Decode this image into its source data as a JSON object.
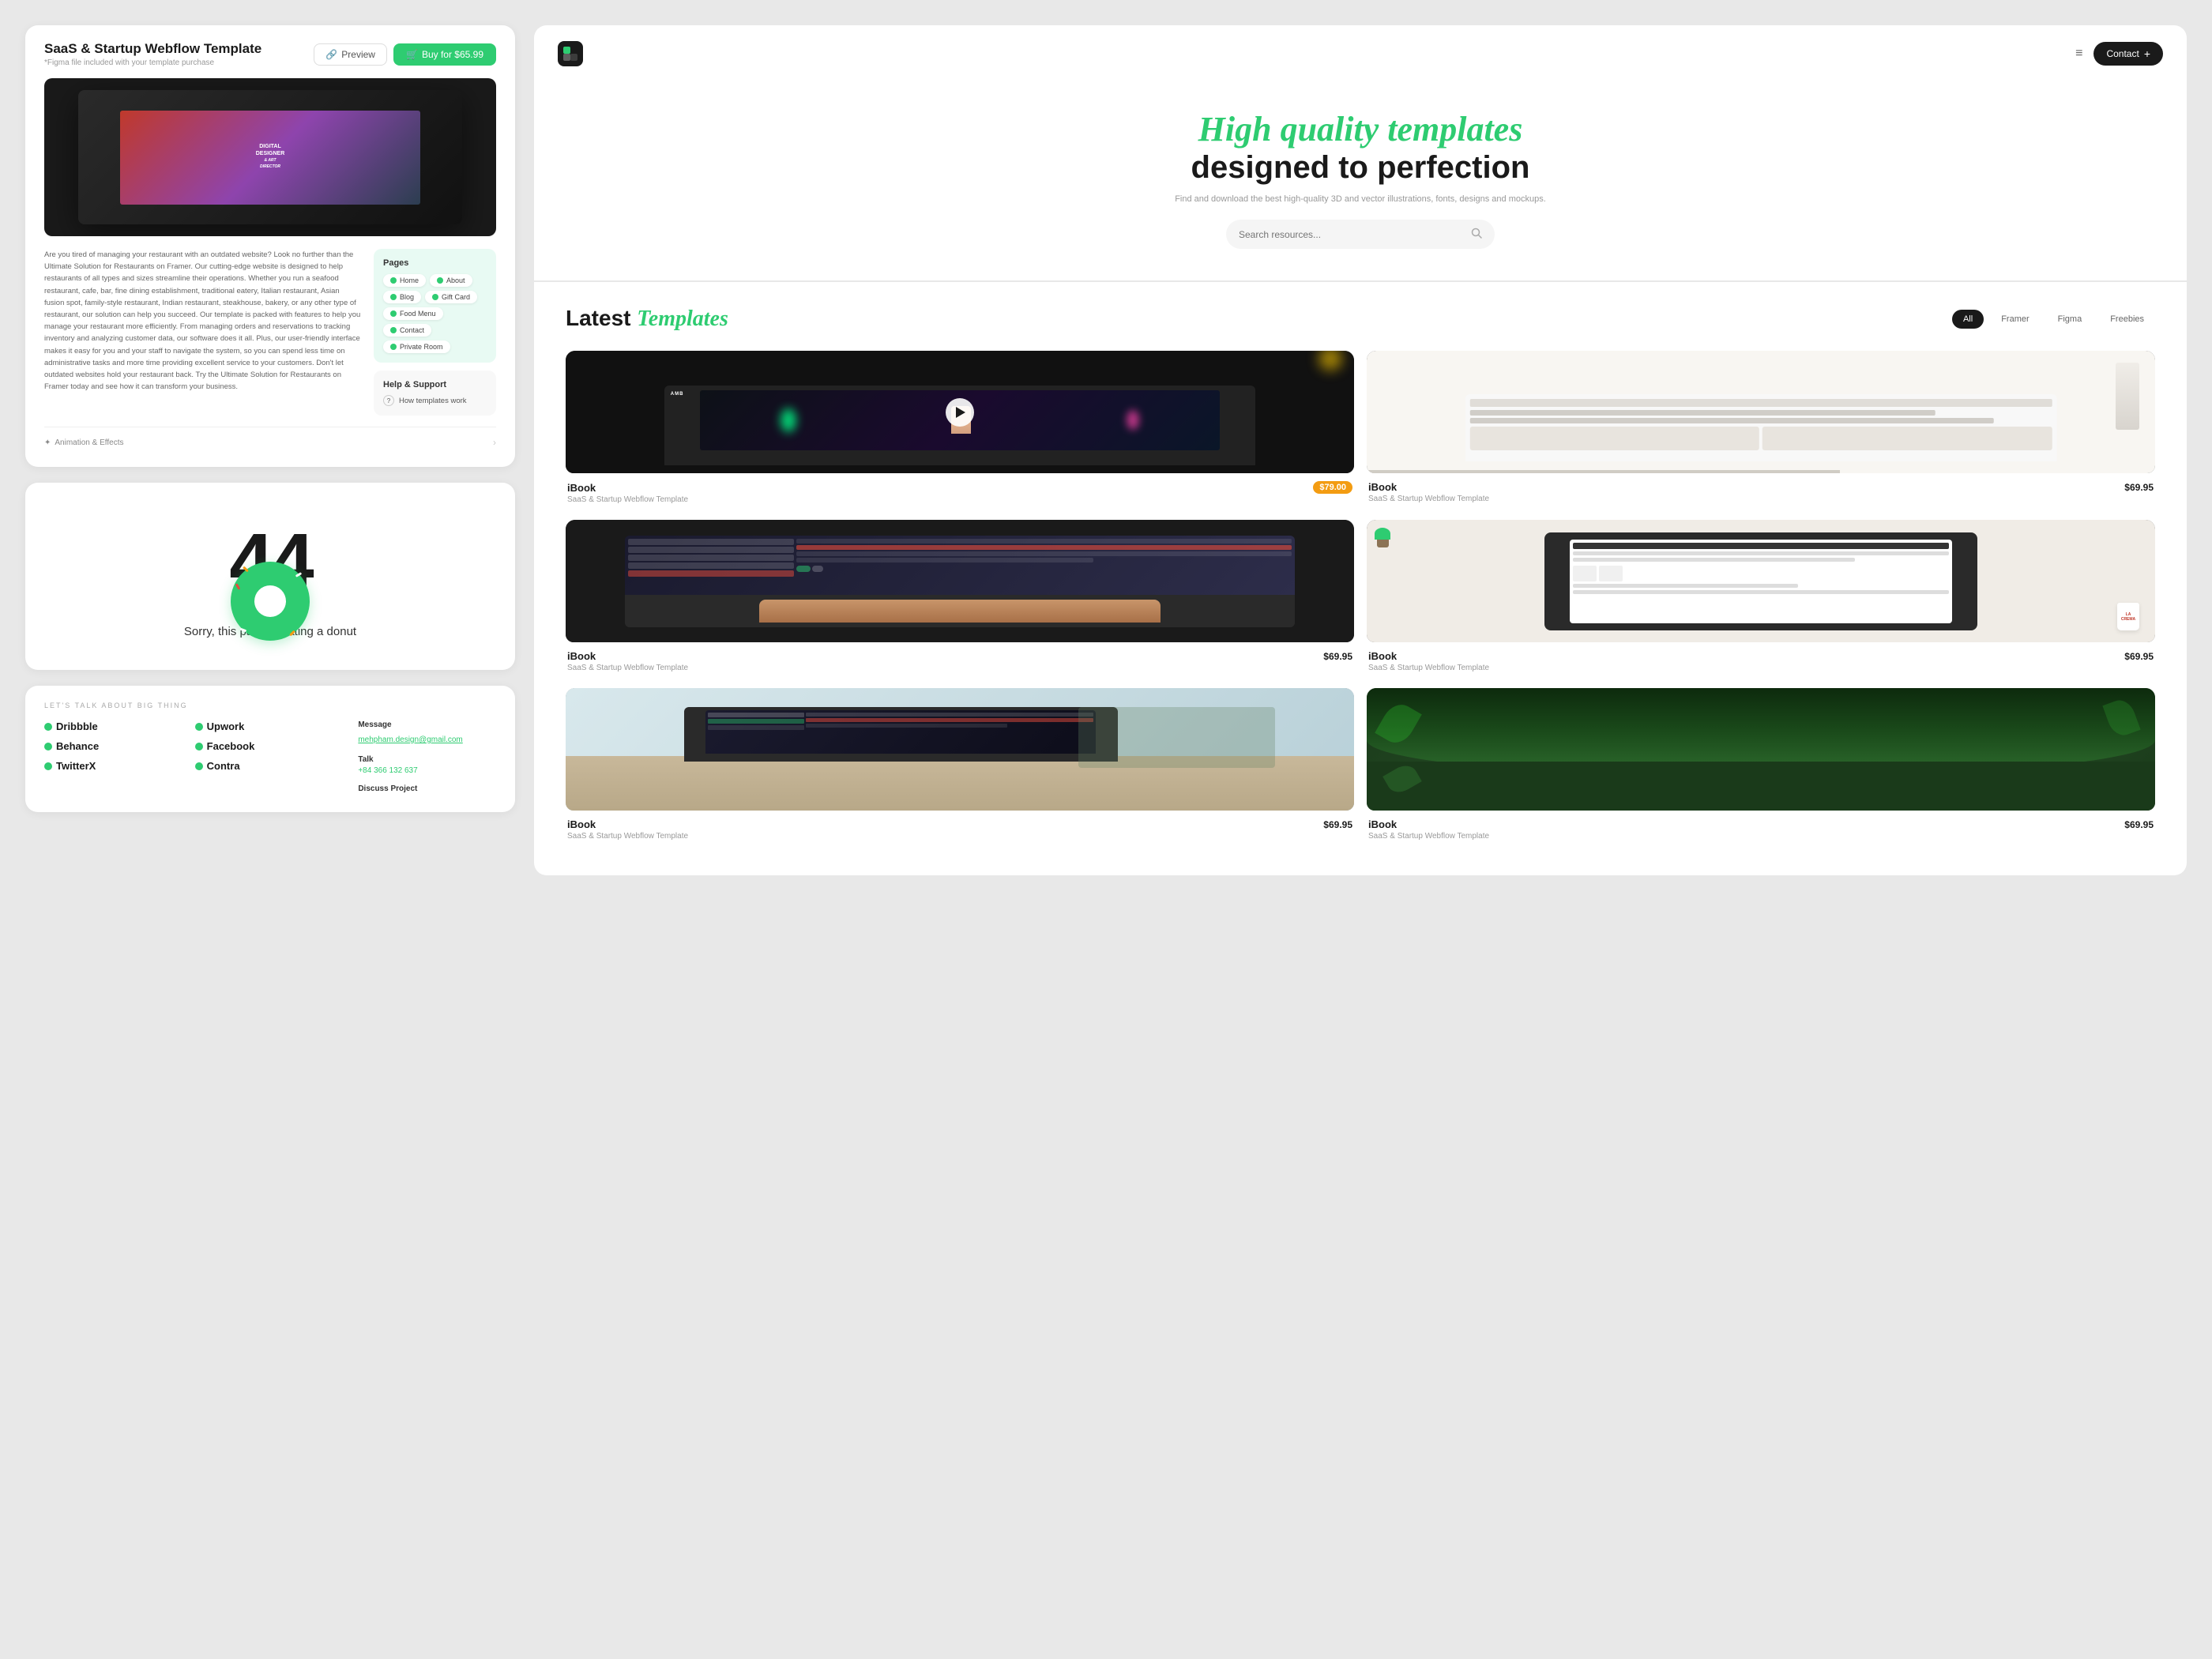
{
  "leftPanel": {
    "templateCard": {
      "title": "SaaS & Startup Webflow Template",
      "subtitle": "*Figma file included with your template purchase",
      "previewLabel": "Preview",
      "buyLabel": "Buy for $65.99",
      "description": "Are you tired of managing your restaurant with an outdated website? Look no further than the Ultimate Solution for Restaurants on Framer. Our cutting-edge website is designed to help restaurants of all types and sizes streamline their operations. Whether you run a seafood restaurant, cafe, bar, fine dining establishment, traditional eatery, Italian restaurant, Asian fusion spot, family-style restaurant, Indian restaurant, steakhouse, bakery, or any other type of restaurant, our solution can help you succeed.\n\nOur template is packed with features to help you manage your restaurant more efficiently. From managing orders and reservations to tracking inventory and analyzing customer data, our software does it all. Plus, our user-friendly interface makes it easy for you and your staff to navigate the system, so you can spend less time on administrative tasks and more time providing excellent service to your customers. Don't let outdated websites hold your restaurant back. Try the Ultimate Solution for Restaurants on Framer today and see how it can transform your business.",
      "laptopText": "DIGITAL DESIGNER & ART DIRECTOR",
      "pages": {
        "title": "Pages",
        "items": [
          "Home",
          "About",
          "Blog",
          "Gift Card",
          "Food Menu",
          "Contact",
          "Private Room"
        ]
      },
      "help": {
        "title": "Help & Support",
        "item": "How templates work"
      },
      "footerLabel": "Animation & Effects"
    },
    "notFoundCard": {
      "title": "404",
      "message": "Sorry, this page is eating a donut"
    },
    "footerCard": {
      "label": "LET'S TALK ABOUT BIG THING",
      "links1": [
        "Dribbble",
        "Behance",
        "TwitterX"
      ],
      "links2": [
        "Upwork",
        "Facebook",
        "Contra"
      ],
      "contact": {
        "messageLabel": "Message",
        "emailValue": "mehpham.design@gmail.com",
        "talkLabel": "Talk",
        "phoneValue": "+84 366 132 637",
        "discussLabel": "Discuss Project"
      }
    }
  },
  "rightPanel": {
    "nav": {
      "logoText": "U",
      "menuIcon": "≡",
      "contactLabel": "Contact",
      "contactPlus": "+"
    },
    "hero": {
      "titleItalic": "High quality templates",
      "titleMain": "designed to perfection",
      "subtitle": "Find and download the best high-quality 3D and vector illustrations, fonts, designs and mockups.",
      "searchPlaceholder": "Search resources..."
    },
    "templates": {
      "sectionTitle": "Latest",
      "sectionTitleItalic": "Templates",
      "filters": [
        "All",
        "Framer",
        "Figma",
        "Freebies"
      ],
      "activeFilter": "All",
      "items": [
        {
          "name": "iBook",
          "description": "SaaS & Startup Webflow Template",
          "price": "$79.00",
          "hasPriceBadge": true,
          "imgType": "neon"
        },
        {
          "name": "iBook",
          "description": "SaaS & Startup Webflow Template",
          "price": "$69.95",
          "hasPriceBadge": false,
          "imgType": "white-desk"
        },
        {
          "name": "iBook",
          "description": "SaaS & Startup Webflow Template",
          "price": "$69.95",
          "hasPriceBadge": false,
          "imgType": "keyboard"
        },
        {
          "name": "iBook",
          "description": "SaaS & Startup Webflow Template",
          "price": "$69.95",
          "hasPriceBadge": false,
          "imgType": "tablet-desk"
        },
        {
          "name": "iBook",
          "description": "SaaS & Startup Webflow Template",
          "price": "$69.95",
          "hasPriceBadge": false,
          "imgType": "multi-device"
        },
        {
          "name": "iBook",
          "description": "SaaS & Startup Webflow Template",
          "price": "$69.95",
          "hasPriceBadge": false,
          "imgType": "green-nature"
        }
      ]
    }
  }
}
